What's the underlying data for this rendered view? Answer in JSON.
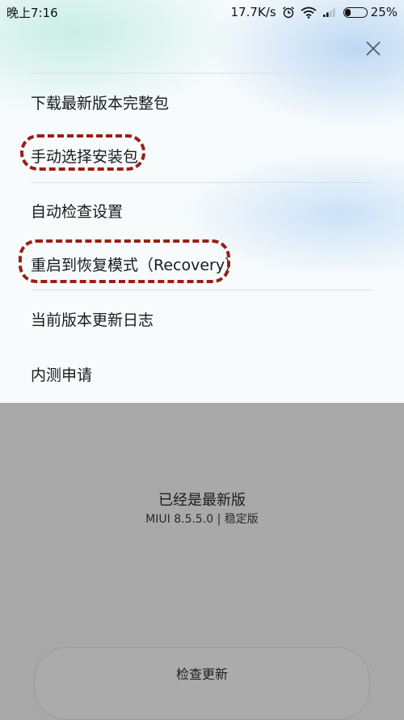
{
  "status_bar": {
    "time": "晚上7:16",
    "speed": "17.7K/s",
    "battery": "25%",
    "battery_level": 0.25,
    "icons": [
      "alarm-icon",
      "wifi-icon",
      "signal-icon",
      "battery-icon"
    ]
  },
  "menu": {
    "items": [
      {
        "label": "下载最新版本完整包"
      },
      {
        "label": "手动选择安装包"
      },
      {
        "label": "自动检查设置"
      },
      {
        "label": "重启到恢复模式（Recovery）"
      },
      {
        "label": "当前版本更新日志"
      },
      {
        "label": "内测申请"
      }
    ]
  },
  "update": {
    "status": "已经是最新版",
    "version": "MIUI 8.5.5.0 | 稳定版",
    "check_button": "检查更新"
  },
  "colors": {
    "annotation": "#9a1f17",
    "overlay": "#a9a9a9"
  }
}
